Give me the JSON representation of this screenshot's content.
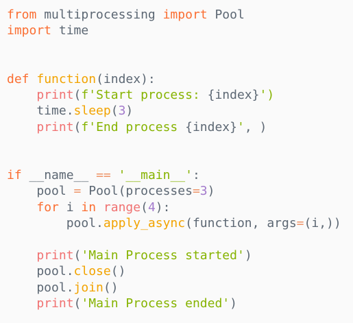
{
  "code": {
    "lines": [
      [
        {
          "t": "from",
          "c": "kw"
        },
        {
          "t": " multiprocessing ",
          "c": "mod"
        },
        {
          "t": "import",
          "c": "kw"
        },
        {
          "t": " Pool",
          "c": "mod"
        }
      ],
      [
        {
          "t": "import",
          "c": "kw"
        },
        {
          "t": " time",
          "c": "mod"
        }
      ],
      [],
      [],
      [
        {
          "t": "def",
          "c": "kw"
        },
        {
          "t": " ",
          "c": "id"
        },
        {
          "t": "function",
          "c": "fn"
        },
        {
          "t": "(index):",
          "c": "punc"
        }
      ],
      [
        {
          "t": "    ",
          "c": "id"
        },
        {
          "t": "print",
          "c": "bi"
        },
        {
          "t": "(",
          "c": "punc"
        },
        {
          "t": "f'Start process: ",
          "c": "str"
        },
        {
          "t": "{index}",
          "c": "id"
        },
        {
          "t": "')",
          "c": "str"
        }
      ],
      [
        {
          "t": "    time.",
          "c": "id"
        },
        {
          "t": "sleep",
          "c": "fn"
        },
        {
          "t": "(",
          "c": "punc"
        },
        {
          "t": "3",
          "c": "num"
        },
        {
          "t": ")",
          "c": "punc"
        }
      ],
      [
        {
          "t": "    ",
          "c": "id"
        },
        {
          "t": "print",
          "c": "bi"
        },
        {
          "t": "(",
          "c": "punc"
        },
        {
          "t": "f'End process ",
          "c": "str"
        },
        {
          "t": "{index}",
          "c": "id"
        },
        {
          "t": "'",
          "c": "str"
        },
        {
          "t": ", )",
          "c": "punc"
        }
      ],
      [],
      [],
      [
        {
          "t": "if",
          "c": "kw"
        },
        {
          "t": " __name__ ",
          "c": "id"
        },
        {
          "t": "==",
          "c": "op"
        },
        {
          "t": " ",
          "c": "id"
        },
        {
          "t": "'__main__'",
          "c": "str"
        },
        {
          "t": ":",
          "c": "punc"
        }
      ],
      [
        {
          "t": "    pool ",
          "c": "id"
        },
        {
          "t": "=",
          "c": "op"
        },
        {
          "t": " Pool(processes",
          "c": "id"
        },
        {
          "t": "=",
          "c": "op"
        },
        {
          "t": "3",
          "c": "num"
        },
        {
          "t": ")",
          "c": "punc"
        }
      ],
      [
        {
          "t": "    ",
          "c": "id"
        },
        {
          "t": "for",
          "c": "kw"
        },
        {
          "t": " i ",
          "c": "id"
        },
        {
          "t": "in",
          "c": "kw"
        },
        {
          "t": " ",
          "c": "id"
        },
        {
          "t": "range",
          "c": "bi"
        },
        {
          "t": "(",
          "c": "punc"
        },
        {
          "t": "4",
          "c": "num"
        },
        {
          "t": "):",
          "c": "punc"
        }
      ],
      [
        {
          "t": "        pool.",
          "c": "id"
        },
        {
          "t": "apply_async",
          "c": "fn"
        },
        {
          "t": "(function, args",
          "c": "id"
        },
        {
          "t": "=",
          "c": "op"
        },
        {
          "t": "(i,))",
          "c": "punc"
        }
      ],
      [],
      [
        {
          "t": "    ",
          "c": "id"
        },
        {
          "t": "print",
          "c": "bi"
        },
        {
          "t": "(",
          "c": "punc"
        },
        {
          "t": "'Main Process started'",
          "c": "str"
        },
        {
          "t": ")",
          "c": "punc"
        }
      ],
      [
        {
          "t": "    pool.",
          "c": "id"
        },
        {
          "t": "close",
          "c": "fn"
        },
        {
          "t": "()",
          "c": "punc"
        }
      ],
      [
        {
          "t": "    pool.",
          "c": "id"
        },
        {
          "t": "join",
          "c": "fn"
        },
        {
          "t": "()",
          "c": "punc"
        }
      ],
      [
        {
          "t": "    ",
          "c": "id"
        },
        {
          "t": "print",
          "c": "bi"
        },
        {
          "t": "(",
          "c": "punc"
        },
        {
          "t": "'Main Process ended'",
          "c": "str"
        },
        {
          "t": ")",
          "c": "punc"
        }
      ]
    ]
  },
  "colors": {
    "background": "#fafafa",
    "keyword": "#fa6e32",
    "function": "#f2a300",
    "string": "#86b300",
    "number": "#a37acc",
    "identifier": "#5c6773",
    "operator": "#ed9366",
    "builtin": "#f07171"
  }
}
